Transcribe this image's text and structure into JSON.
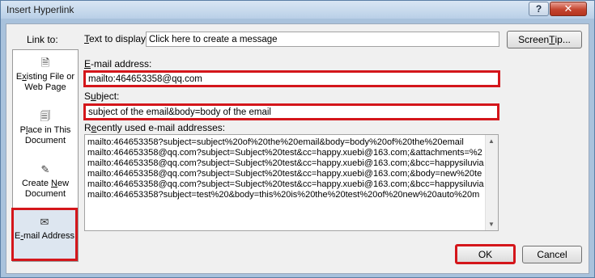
{
  "window": {
    "title": "Insert Hyperlink",
    "help_glyph": "?",
    "close_glyph": "✕"
  },
  "link_to": {
    "label": "Link to:",
    "items": [
      {
        "line1": "Existing File or",
        "line2": "Web Page",
        "icon": "globe-document-icon",
        "glyph": "🗎"
      },
      {
        "line1": "Place in This",
        "line2": "Document",
        "icon": "document-place-icon",
        "glyph": "🗐"
      },
      {
        "line1": "Create New",
        "line2": "Document",
        "icon": "new-document-icon",
        "glyph": "✎"
      },
      {
        "line1": "E-mail Address",
        "line2": "",
        "icon": "email-icon",
        "glyph": "✉"
      }
    ],
    "selected_index": 3
  },
  "text_to_display": {
    "label": "Text to display:",
    "value": "Click here to create a message"
  },
  "screentip_button": "ScreenTip...",
  "email_address": {
    "label": "E-mail address:",
    "value": "mailto:464653358@qq.com"
  },
  "subject": {
    "label": "Subject:",
    "value": "subject of the email&body=body of the email"
  },
  "recent": {
    "label": "Recently used e-mail addresses:",
    "rows": [
      "mailto:464653358?subject=subject%20of%20the%20email&body=body%20of%20the%20email",
      "mailto:464653358@qq.com?subject=Subject%20test&cc=happy.xuebi@163.com;&attachments=%2",
      "mailto:464653358@qq.com?subject=Subject%20test&cc=happy.xuebi@163.com;&bcc=happysiluvia",
      "mailto:464653358@qq.com?subject=Subject%20test&cc=happy.xuebi@163.com;&body=new%20te",
      "mailto:464653358@qq.com?subject=Subject%20test&cc=happy.xuebi@163.com;&bcc=happysiluvia",
      "mailto:464653358?subject=test%20&body=this%20is%20the%20test%20of%20new%20auto%20m"
    ]
  },
  "ok_button": "OK",
  "cancel_button": "Cancel",
  "colors": {
    "highlight_red": "#d4161b",
    "selected_bg": "#dde6f0"
  }
}
